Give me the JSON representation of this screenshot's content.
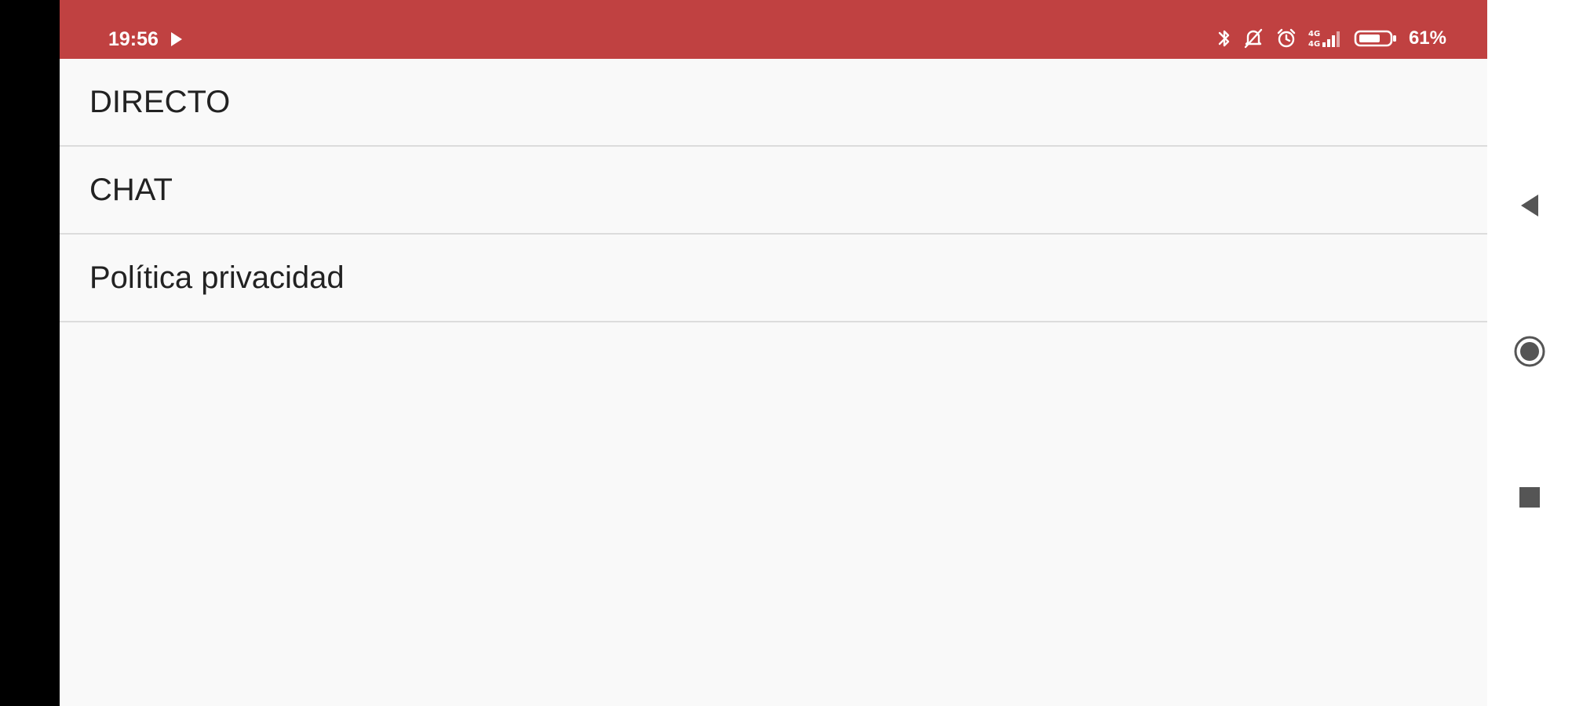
{
  "status_bar": {
    "time": "19:56",
    "battery_percent": "61%",
    "icons": [
      "play-icon",
      "bluetooth-icon",
      "do-not-disturb-icon",
      "alarm-icon",
      "signal-icon",
      "battery-icon"
    ],
    "background_color": "#c04141"
  },
  "menu": {
    "items": [
      {
        "label": "DIRECTO"
      },
      {
        "label": "CHAT"
      },
      {
        "label": "Política privacidad"
      }
    ]
  },
  "nav_bar": {
    "buttons": [
      "back-icon",
      "home-icon",
      "recents-icon"
    ]
  }
}
